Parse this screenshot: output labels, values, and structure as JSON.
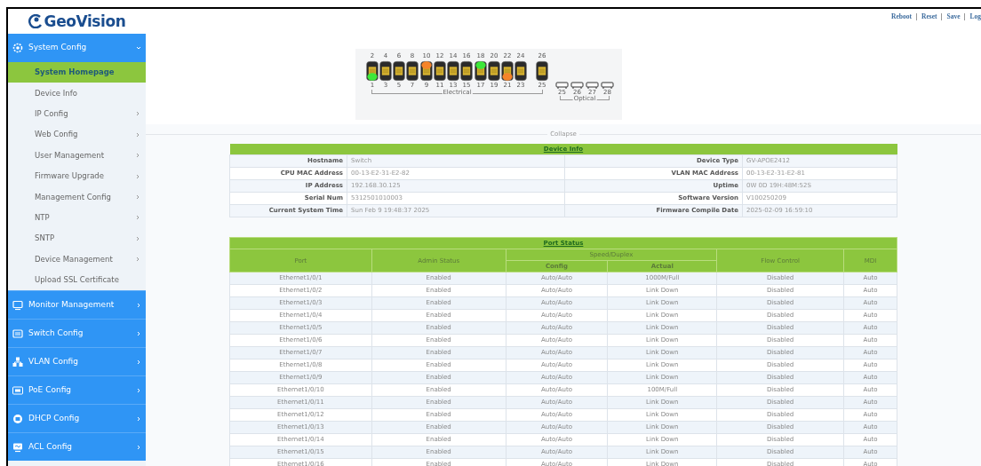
{
  "logo": {
    "text": "GeoVision"
  },
  "top_links": [
    "Reboot",
    "Reset",
    "Save",
    "Log"
  ],
  "sidebar": [
    {
      "label": "System Config",
      "expanded": true,
      "items": [
        {
          "label": "System Homepage",
          "selected": true,
          "has_submenu": false
        },
        {
          "label": "Device Info",
          "selected": false,
          "has_submenu": false
        },
        {
          "label": "IP Config",
          "selected": false,
          "has_submenu": true
        },
        {
          "label": "Web Config",
          "selected": false,
          "has_submenu": true
        },
        {
          "label": "User Management",
          "selected": false,
          "has_submenu": true
        },
        {
          "label": "Firmware Upgrade",
          "selected": false,
          "has_submenu": true
        },
        {
          "label": "Management Config",
          "selected": false,
          "has_submenu": true
        },
        {
          "label": "NTP",
          "selected": false,
          "has_submenu": true
        },
        {
          "label": "SNTP",
          "selected": false,
          "has_submenu": true
        },
        {
          "label": "Device Management",
          "selected": false,
          "has_submenu": true
        },
        {
          "label": "Upload SSL Certificate",
          "selected": false,
          "has_submenu": false
        }
      ]
    },
    {
      "label": "Monitor Management",
      "expanded": false
    },
    {
      "label": "Switch Config",
      "expanded": false
    },
    {
      "label": "VLAN Config",
      "expanded": false
    },
    {
      "label": "PoE Config",
      "expanded": false
    },
    {
      "label": "DHCP Config",
      "expanded": false
    },
    {
      "label": "ACL Config",
      "expanded": false
    }
  ],
  "switch_panel": {
    "electrical_columns": [
      {
        "upper": {
          "number": "2",
          "lit": false
        },
        "lower": {
          "number": "1",
          "lit": true,
          "color": "#3de83a"
        }
      },
      {
        "upper": {
          "number": "4",
          "lit": false
        },
        "lower": {
          "number": "3",
          "lit": false
        }
      },
      {
        "upper": {
          "number": "6",
          "lit": false
        },
        "lower": {
          "number": "5",
          "lit": false
        }
      },
      {
        "upper": {
          "number": "8",
          "lit": false
        },
        "lower": {
          "number": "7",
          "lit": false
        }
      },
      {
        "upper": {
          "number": "10",
          "lit": true,
          "color": "#f5842a"
        },
        "lower": {
          "number": "9",
          "lit": false
        }
      },
      {
        "upper": {
          "number": "12",
          "lit": false
        },
        "lower": {
          "number": "11",
          "lit": false
        }
      },
      {
        "upper": {
          "number": "14",
          "lit": false
        },
        "lower": {
          "number": "13",
          "lit": false
        }
      },
      {
        "upper": {
          "number": "16",
          "lit": false
        },
        "lower": {
          "number": "15",
          "lit": false
        }
      },
      {
        "upper": {
          "number": "18",
          "lit": true,
          "color": "#3de83a"
        },
        "lower": {
          "number": "17",
          "lit": false
        }
      },
      {
        "upper": {
          "number": "20",
          "lit": false
        },
        "lower": {
          "number": "19",
          "lit": false
        }
      },
      {
        "upper": {
          "number": "22",
          "lit": false
        },
        "lower": {
          "number": "21",
          "lit": true,
          "color": "#f5842a"
        }
      },
      {
        "upper": {
          "number": "24",
          "lit": false
        },
        "lower": {
          "number": "23",
          "lit": false
        }
      },
      {
        "upper": {
          "number": "26",
          "lit": false
        },
        "lower": {
          "number": "25",
          "lit": false
        }
      }
    ],
    "electrical_label": "Electrical",
    "optical_ports": [
      "25",
      "26",
      "27",
      "28"
    ],
    "optical_label": "Optical"
  },
  "collapse_label": "Collapse",
  "device_info": {
    "title": "Device Info",
    "rows": [
      {
        "left_label": "Hostname",
        "left_value": "Switch",
        "right_label": "Device Type",
        "right_value": "GV-APOE2412"
      },
      {
        "left_label": "CPU MAC Address",
        "left_value": "00-13-E2-31-E2-82",
        "right_label": "VLAN MAC Address",
        "right_value": "00-13-E2-31-E2-81"
      },
      {
        "left_label": "IP Address",
        "left_value": "192.168.30.125",
        "right_label": "Uptime",
        "right_value": "0W 0D 19H:48M:52S"
      },
      {
        "left_label": "Serial Num",
        "left_value": "5312501010003",
        "right_label": "Software Version",
        "right_value": "V100250209"
      },
      {
        "left_label": "Current System Time",
        "left_value": "Sun Feb 9 19:48:37 2025",
        "right_label": "Firmware Compile Date",
        "right_value": "2025-02-09 16:59:10"
      }
    ]
  },
  "port_status": {
    "title": "Port Status",
    "headers": {
      "port": "Port",
      "admin": "Admin Status",
      "speed_duplex": "Speed/Duplex",
      "config": "Config",
      "actual": "Actual",
      "flow": "Flow Control",
      "mdi": "MDI"
    },
    "rows": [
      [
        "Ethernet1/0/1",
        "Enabled",
        "Auto/Auto",
        "1000M/Full",
        "Disabled",
        "Auto"
      ],
      [
        "Ethernet1/0/2",
        "Enabled",
        "Auto/Auto",
        "Link Down",
        "Disabled",
        "Auto"
      ],
      [
        "Ethernet1/0/3",
        "Enabled",
        "Auto/Auto",
        "Link Down",
        "Disabled",
        "Auto"
      ],
      [
        "Ethernet1/0/4",
        "Enabled",
        "Auto/Auto",
        "Link Down",
        "Disabled",
        "Auto"
      ],
      [
        "Ethernet1/0/5",
        "Enabled",
        "Auto/Auto",
        "Link Down",
        "Disabled",
        "Auto"
      ],
      [
        "Ethernet1/0/6",
        "Enabled",
        "Auto/Auto",
        "Link Down",
        "Disabled",
        "Auto"
      ],
      [
        "Ethernet1/0/7",
        "Enabled",
        "Auto/Auto",
        "Link Down",
        "Disabled",
        "Auto"
      ],
      [
        "Ethernet1/0/8",
        "Enabled",
        "Auto/Auto",
        "Link Down",
        "Disabled",
        "Auto"
      ],
      [
        "Ethernet1/0/9",
        "Enabled",
        "Auto/Auto",
        "Link Down",
        "Disabled",
        "Auto"
      ],
      [
        "Ethernet1/0/10",
        "Enabled",
        "Auto/Auto",
        "100M/Full",
        "Disabled",
        "Auto"
      ],
      [
        "Ethernet1/0/11",
        "Enabled",
        "Auto/Auto",
        "Link Down",
        "Disabled",
        "Auto"
      ],
      [
        "Ethernet1/0/12",
        "Enabled",
        "Auto/Auto",
        "Link Down",
        "Disabled",
        "Auto"
      ],
      [
        "Ethernet1/0/13",
        "Enabled",
        "Auto/Auto",
        "Link Down",
        "Disabled",
        "Auto"
      ],
      [
        "Ethernet1/0/14",
        "Enabled",
        "Auto/Auto",
        "Link Down",
        "Disabled",
        "Auto"
      ],
      [
        "Ethernet1/0/15",
        "Enabled",
        "Auto/Auto",
        "Link Down",
        "Disabled",
        "Auto"
      ],
      [
        "Ethernet1/0/16",
        "Enabled",
        "Auto/Auto",
        "Link Down",
        "Disabled",
        "Auto"
      ]
    ]
  }
}
